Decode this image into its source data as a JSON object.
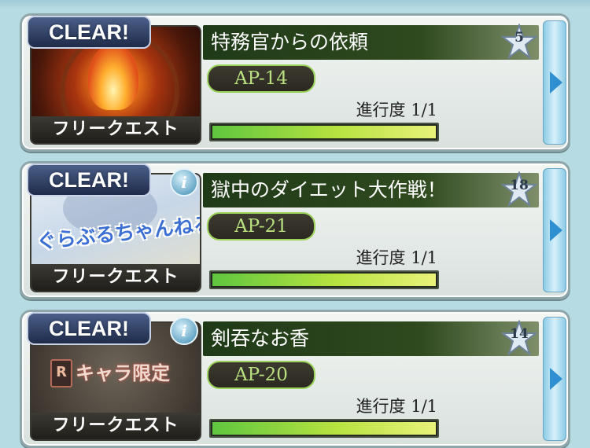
{
  "quests": [
    {
      "clear_label": "CLEAR!",
      "thumb_type": "fire",
      "thumb_label": "フリークエスト",
      "has_info_icon": false,
      "title": "特務官からの依頼",
      "star_number": "5",
      "ap": "AP-14",
      "progress_label": "進行度",
      "progress_value": "1/1",
      "progress_fraction": 1.0
    },
    {
      "clear_label": "CLEAR!",
      "thumb_type": "radio",
      "thumb_logo": "ぐらぶるちゃんねる!",
      "thumb_label": "フリークエスト",
      "has_info_icon": true,
      "info_icon": "i",
      "title": "獄中のダイエット大作戦！",
      "star_number": "18",
      "ap": "AP-21",
      "progress_label": "進行度",
      "progress_value": "1/1",
      "progress_fraction": 1.0
    },
    {
      "clear_label": "CLEAR!",
      "thumb_type": "chara",
      "thumb_badge": "R",
      "thumb_chara": "キャラ限定",
      "thumb_label": "フリークエスト",
      "has_info_icon": true,
      "info_icon": "i",
      "title": "剣吞なお香",
      "star_number": "14",
      "ap": "AP-20",
      "progress_label": "進行度",
      "progress_value": "1/1",
      "progress_fraction": 1.0
    }
  ],
  "colors": {
    "title_bar": "#2f4a1f",
    "ap_border": "#9bd35a",
    "progress_fill": "#b6e23f",
    "go_button": "#8ccbe6"
  },
  "icons": {
    "star": "star-rank-icon",
    "go": "arrow-right-icon",
    "info": "info-icon"
  }
}
